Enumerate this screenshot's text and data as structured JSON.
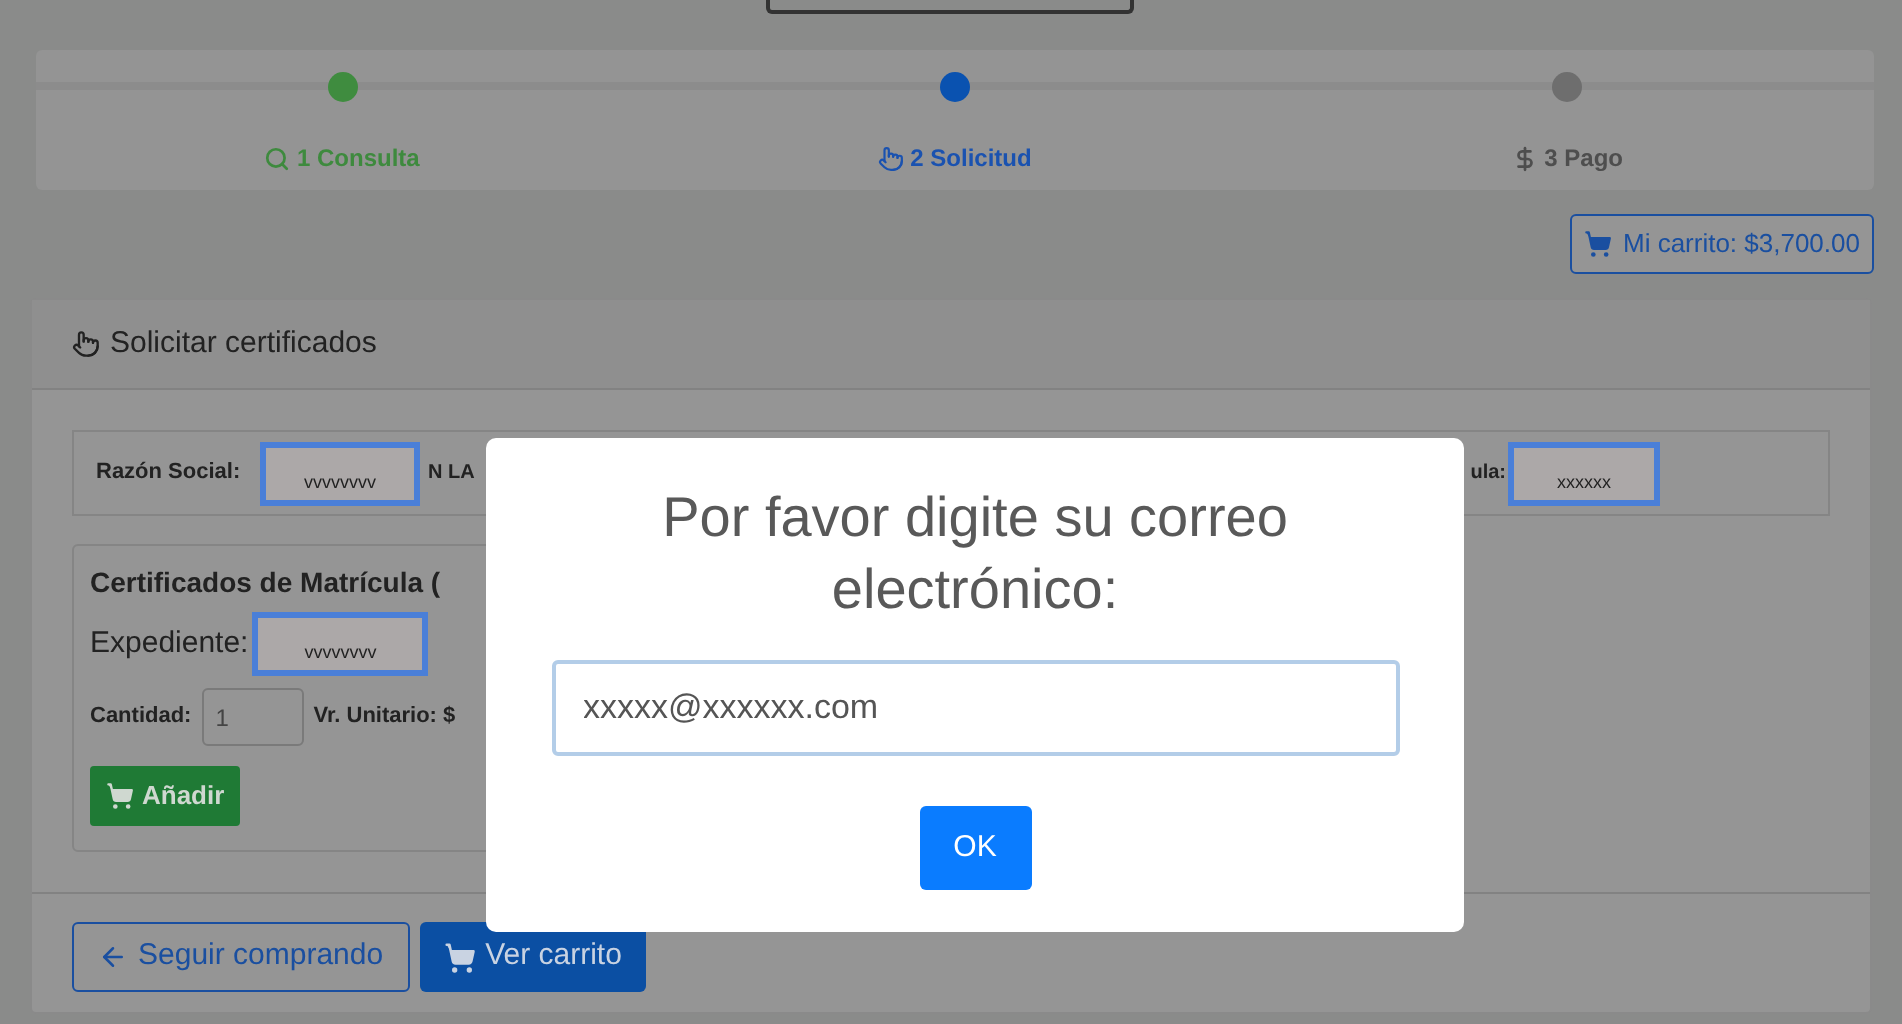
{
  "steps": [
    {
      "label": "1 Consulta",
      "kind": "done"
    },
    {
      "label": "2 Solicitud",
      "kind": "current"
    },
    {
      "label": "3 Pago",
      "kind": "pending"
    }
  ],
  "cart_button": {
    "label": "Mi carrito: $3,700.00"
  },
  "panel": {
    "title": "Solicitar certificados",
    "info_row": {
      "razon_social_label": "Razón Social:",
      "razon_social_value": "vvvvvvvv",
      "name_fragment": "N LA",
      "matricula_label_fragment": "ula:",
      "matricula_value": "xxxxxx"
    },
    "certificate_card": {
      "title": "Certificados de Matrícula (",
      "expediente_label": "Expediente:",
      "expediente_value": "vvvvvvvv",
      "quantity_label": "Cantidad:",
      "quantity_value": "1",
      "unit_price_label": "Vr. Unitario: $",
      "add_button": "Añadir"
    },
    "footer_buttons": [
      {
        "label": "Seguir comprando",
        "kind": "outline"
      },
      {
        "label": "Ver carrito",
        "kind": "solid"
      }
    ]
  },
  "modal": {
    "title": "Por favor digite su correo electrónico:",
    "email_value": "xxxxx@xxxxxx.com",
    "ok_button": "OK"
  }
}
